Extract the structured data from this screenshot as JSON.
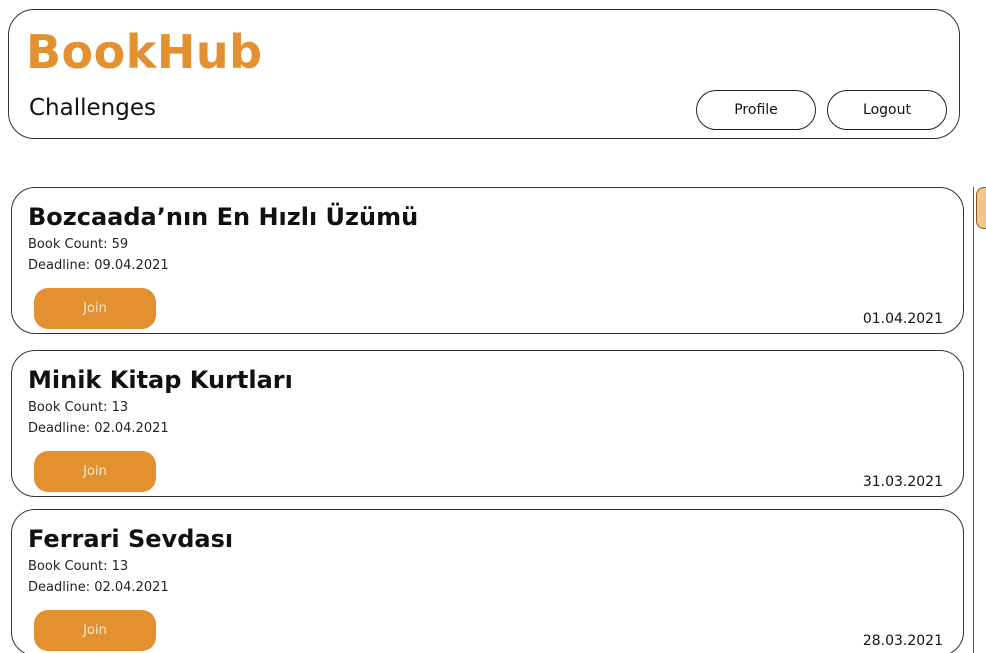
{
  "app": {
    "brand": "BookHub",
    "page_title": "Challenges"
  },
  "header": {
    "profile_label": "Profile",
    "logout_label": "Logout"
  },
  "challenges": [
    {
      "title": "Bozcaada’nın En Hızlı Üzümü",
      "book_count": "Book Count: 59",
      "deadline": "Deadline: 09.04.2021",
      "join_label": "Join",
      "date": "01.04.2021"
    },
    {
      "title": "Minik Kitap Kurtları",
      "book_count": "Book Count: 13",
      "deadline": "Deadline: 02.04.2021",
      "join_label": "Join",
      "date": "31.03.2021"
    },
    {
      "title": "Ferrari Sevdası",
      "book_count": "Book Count: 13",
      "deadline": "Deadline: 02.04.2021",
      "join_label": "Join",
      "date": "28.03.2021"
    }
  ],
  "colors": {
    "accent": "#e39130",
    "button_text": "#fbe8cf",
    "scroll_thumb": "#f3c58d"
  }
}
